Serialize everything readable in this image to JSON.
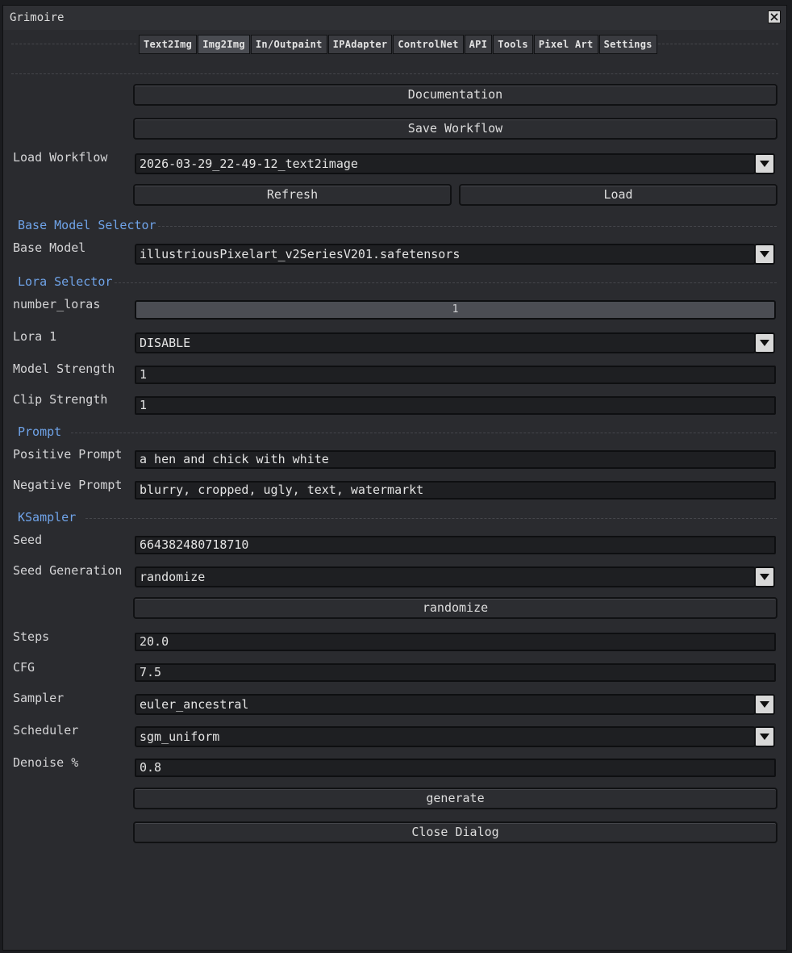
{
  "window": {
    "title": "Grimoire"
  },
  "tabs": [
    "Text2Img",
    "Img2Img",
    "In/Outpaint",
    "IPAdapter",
    "ControlNet",
    "API",
    "Tools",
    "Pixel Art",
    "Settings"
  ],
  "buttons": {
    "documentation": "Documentation",
    "save_workflow": "Save Workflow",
    "refresh": "Refresh",
    "load": "Load",
    "randomize": "randomize",
    "generate": "generate",
    "close_dialog": "Close Dialog"
  },
  "load_workflow": {
    "label": "Load Workflow",
    "value": "2026-03-29_22-49-12_text2image"
  },
  "base_model_section": {
    "title": "Base Model Selector",
    "label": "Base Model",
    "value": "illustriousPixelart_v2SeriesV201.safetensors"
  },
  "lora_section": {
    "title": "Lora Selector",
    "number_loras_label": "number_loras",
    "number_loras_value": "1",
    "lora1_label": "Lora 1",
    "lora1_value": "DISABLE",
    "model_strength_label": "Model Strength",
    "model_strength_value": "1",
    "clip_strength_label": "Clip Strength",
    "clip_strength_value": "1"
  },
  "prompt_section": {
    "title": "Prompt",
    "positive_label": "Positive Prompt",
    "positive_value": "a hen and chick with white",
    "negative_label": "Negative Prompt",
    "negative_value": "blurry, cropped, ugly, text, watermarkt"
  },
  "ksampler_section": {
    "title": "KSampler",
    "seed_label": "Seed",
    "seed_value": "664382480718710",
    "seed_gen_label": "Seed Generation",
    "seed_gen_value": "randomize",
    "steps_label": "Steps",
    "steps_value": "20.0",
    "cfg_label": "CFG",
    "cfg_value": "7.5",
    "sampler_label": "Sampler",
    "sampler_value": "euler_ancestral",
    "scheduler_label": "Scheduler",
    "scheduler_value": "sgm_uniform",
    "denoise_label": "Denoise %",
    "denoise_value": "0.8"
  }
}
